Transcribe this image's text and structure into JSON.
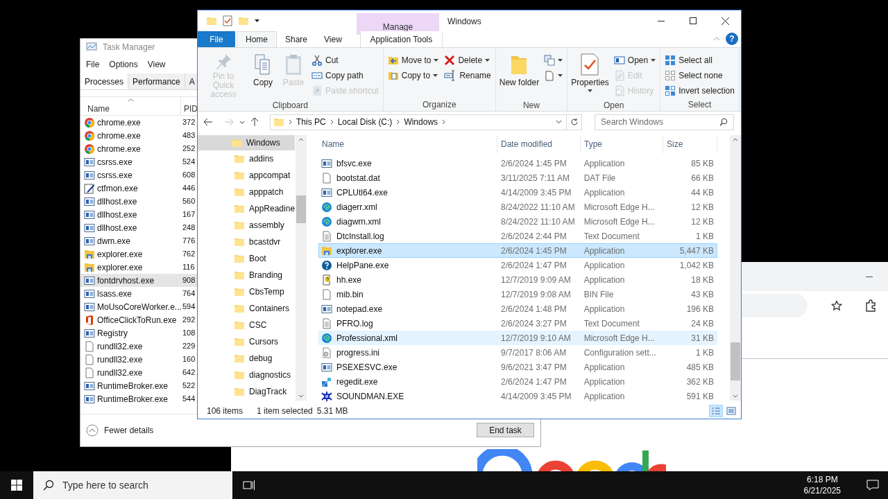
{
  "task_manager": {
    "title": "Task Manager",
    "menu": [
      "File",
      "Options",
      "View"
    ],
    "tabs": [
      {
        "label": "Processes",
        "selected": true
      },
      {
        "label": "Performance",
        "selected": false
      },
      {
        "label": "A",
        "selected": false
      }
    ],
    "columns": [
      "Name",
      "PID"
    ],
    "rows": [
      {
        "name": "chrome.exe",
        "pid": "372",
        "kind": "chrome",
        "selected": false
      },
      {
        "name": "chrome.exe",
        "pid": "483",
        "kind": "chrome",
        "selected": false
      },
      {
        "name": "chrome.exe",
        "pid": "252",
        "kind": "chrome",
        "selected": false
      },
      {
        "name": "csrss.exe",
        "pid": "524",
        "kind": "app",
        "selected": false
      },
      {
        "name": "csrss.exe",
        "pid": "608",
        "kind": "app",
        "selected": false
      },
      {
        "name": "ctfmon.exe",
        "pid": "446",
        "kind": "pen",
        "selected": false
      },
      {
        "name": "dllhost.exe",
        "pid": "560",
        "kind": "app",
        "selected": false
      },
      {
        "name": "dllhost.exe",
        "pid": "167",
        "kind": "app",
        "selected": false
      },
      {
        "name": "dllhost.exe",
        "pid": "248",
        "kind": "app",
        "selected": false
      },
      {
        "name": "dwm.exe",
        "pid": "776",
        "kind": "app",
        "selected": false
      },
      {
        "name": "explorer.exe",
        "pid": "762",
        "kind": "explorer",
        "selected": false
      },
      {
        "name": "explorer.exe",
        "pid": "116",
        "kind": "explorer",
        "selected": false
      },
      {
        "name": "fontdrvhost.exe",
        "pid": "908",
        "kind": "app",
        "selected": true
      },
      {
        "name": "lsass.exe",
        "pid": "764",
        "kind": "app",
        "selected": false
      },
      {
        "name": "MoUsoCoreWorker.e...",
        "pid": "594",
        "kind": "app",
        "selected": false
      },
      {
        "name": "OfficeClickToRun.exe",
        "pid": "292",
        "kind": "office",
        "selected": false
      },
      {
        "name": "Registry",
        "pid": "108",
        "kind": "app",
        "selected": false
      },
      {
        "name": "rundll32.exe",
        "pid": "229",
        "kind": "blank",
        "selected": false
      },
      {
        "name": "rundll32.exe",
        "pid": "160",
        "kind": "blank",
        "selected": false
      },
      {
        "name": "rundll32.exe",
        "pid": "642",
        "kind": "blank",
        "selected": false
      },
      {
        "name": "RuntimeBroker.exe",
        "pid": "522",
        "kind": "app",
        "selected": false
      },
      {
        "name": "RuntimeBroker.exe",
        "pid": "544",
        "kind": "app",
        "selected": false
      }
    ],
    "fewer_details": "Fewer details",
    "end_task": "End task"
  },
  "explorer": {
    "title": "Windows",
    "context_tab": "Manage",
    "tabs": [
      {
        "label": "File",
        "kind": "file",
        "selected": false
      },
      {
        "label": "Home",
        "kind": "tab",
        "selected": true
      },
      {
        "label": "Share",
        "kind": "tab",
        "selected": false
      },
      {
        "label": "View",
        "kind": "tab",
        "selected": false
      },
      {
        "label": "Application Tools",
        "kind": "context",
        "selected": false
      }
    ],
    "help": "?",
    "ribbon": [
      {
        "label": "Clipboard",
        "columns": [
          [
            {
              "kind": "big",
              "label": "Pin to Quick access",
              "disabled": true
            }
          ],
          [
            {
              "kind": "big",
              "label": "Copy",
              "disabled": false
            }
          ],
          [
            {
              "kind": "big",
              "label": "Paste",
              "disabled": true
            }
          ],
          [
            {
              "kind": "small",
              "label": "Cut",
              "disabled": false
            },
            {
              "kind": "small",
              "label": "Copy path",
              "disabled": false
            },
            {
              "kind": "small",
              "label": "Paste shortcut",
              "disabled": true
            }
          ]
        ]
      },
      {
        "label": "Organize",
        "columns": [
          [
            {
              "kind": "small",
              "label": "Move to",
              "disabled": false,
              "dropdown": true
            },
            {
              "kind": "small",
              "label": "Copy to",
              "disabled": false,
              "dropdown": true
            }
          ],
          [
            {
              "kind": "small",
              "label": "Delete",
              "disabled": false,
              "dropdown": true
            },
            {
              "kind": "small",
              "label": "Rename",
              "disabled": false
            }
          ]
        ]
      },
      {
        "label": "New",
        "columns": [
          [
            {
              "kind": "big",
              "label": "New folder",
              "disabled": false
            }
          ],
          [
            {
              "kind": "icon",
              "disabled": false,
              "dropdown": true
            },
            {
              "kind": "icon",
              "disabled": false,
              "dropdown": true
            }
          ]
        ]
      },
      {
        "label": "Open",
        "columns": [
          [
            {
              "kind": "big",
              "label": "Properties",
              "disabled": false,
              "dropdown": true
            }
          ],
          [
            {
              "kind": "small",
              "label": "Open",
              "disabled": false,
              "dropdown": true
            },
            {
              "kind": "small",
              "label": "Edit",
              "disabled": true
            },
            {
              "kind": "small",
              "label": "History",
              "disabled": true
            }
          ]
        ]
      },
      {
        "label": "Select",
        "columns": [
          [
            {
              "kind": "small",
              "label": "Select all",
              "disabled": false
            },
            {
              "kind": "small",
              "label": "Select none",
              "disabled": false
            },
            {
              "kind": "small",
              "label": "Invert selection",
              "disabled": false
            }
          ]
        ]
      }
    ],
    "breadcrumbs": [
      "This PC",
      "Local Disk (C:)",
      "Windows"
    ],
    "search": {
      "placeholder": "Search Windows"
    },
    "tree": [
      {
        "label": "Windows",
        "selected": true,
        "children": [
          {
            "label": "addins",
            "selected": false
          },
          {
            "label": "appcompat",
            "selected": false
          },
          {
            "label": "apppatch",
            "selected": false
          },
          {
            "label": "AppReadine",
            "selected": false
          },
          {
            "label": "assembly",
            "selected": false
          },
          {
            "label": "bcastdvr",
            "selected": false
          },
          {
            "label": "Boot",
            "selected": false
          },
          {
            "label": "Branding",
            "selected": false
          },
          {
            "label": "CbsTemp",
            "selected": false
          },
          {
            "label": "Containers",
            "selected": false
          },
          {
            "label": "CSC",
            "selected": false
          },
          {
            "label": "Cursors",
            "selected": false
          },
          {
            "label": "debug",
            "selected": false
          },
          {
            "label": "diagnostics",
            "selected": false
          },
          {
            "label": "DiagTrack",
            "selected": false
          }
        ]
      }
    ],
    "columns": [
      "Name",
      "Date modified",
      "Type",
      "Size"
    ],
    "files": [
      {
        "name": "bfsvc.exe",
        "date": "2/6/2024 1:45 PM",
        "type": "Application",
        "size": "85 KB",
        "kind": "app",
        "selected": false,
        "hot": false
      },
      {
        "name": "bootstat.dat",
        "date": "3/11/2025 7:11 AM",
        "type": "DAT File",
        "size": "66 KB",
        "kind": "blank",
        "selected": false,
        "hot": false
      },
      {
        "name": "CPLUtl64.exe",
        "date": "4/14/2009 3:45 PM",
        "type": "Application",
        "size": "44 KB",
        "kind": "app",
        "selected": false,
        "hot": false
      },
      {
        "name": "diagerr.xml",
        "date": "8/24/2022 11:10 AM",
        "type": "Microsoft Edge H...",
        "size": "12 KB",
        "kind": "edge",
        "selected": false,
        "hot": false
      },
      {
        "name": "diagwrn.xml",
        "date": "8/24/2022 11:10 AM",
        "type": "Microsoft Edge H...",
        "size": "12 KB",
        "kind": "edge",
        "selected": false,
        "hot": false
      },
      {
        "name": "DtcInstall.log",
        "date": "2/6/2024 2:44 PM",
        "type": "Text Document",
        "size": "1 KB",
        "kind": "text",
        "selected": false,
        "hot": false
      },
      {
        "name": "explorer.exe",
        "date": "2/6/2024 1:45 PM",
        "type": "Application",
        "size": "5,447 KB",
        "kind": "explorer",
        "selected": true,
        "hot": false
      },
      {
        "name": "HelpPane.exe",
        "date": "2/6/2024 1:47 PM",
        "type": "Application",
        "size": "1,042 KB",
        "kind": "help",
        "selected": false,
        "hot": false
      },
      {
        "name": "hh.exe",
        "date": "12/7/2019 9:09 AM",
        "type": "Application",
        "size": "18 KB",
        "kind": "hh",
        "selected": false,
        "hot": false
      },
      {
        "name": "mib.bin",
        "date": "12/7/2019 9:08 AM",
        "type": "BIN File",
        "size": "43 KB",
        "kind": "blank",
        "selected": false,
        "hot": false
      },
      {
        "name": "notepad.exe",
        "date": "2/6/2024 1:48 PM",
        "type": "Application",
        "size": "196 KB",
        "kind": "app",
        "selected": false,
        "hot": false
      },
      {
        "name": "PFRO.log",
        "date": "2/6/2024 3:27 PM",
        "type": "Text Document",
        "size": "24 KB",
        "kind": "text",
        "selected": false,
        "hot": false
      },
      {
        "name": "Professional.xml",
        "date": "12/7/2019 9:10 AM",
        "type": "Microsoft Edge H...",
        "size": "31 KB",
        "kind": "edge",
        "selected": false,
        "hot": true
      },
      {
        "name": "progress.ini",
        "date": "9/7/2017 8:06 AM",
        "type": "Configuration sett...",
        "size": "1 KB",
        "kind": "ini",
        "selected": false,
        "hot": false
      },
      {
        "name": "PSEXESVC.exe",
        "date": "9/6/2021 3:47 PM",
        "type": "Application",
        "size": "485 KB",
        "kind": "app",
        "selected": false,
        "hot": false
      },
      {
        "name": "regedit.exe",
        "date": "2/6/2024 1:47 PM",
        "type": "Application",
        "size": "362 KB",
        "kind": "regedit",
        "selected": false,
        "hot": false
      },
      {
        "name": "SOUNDMAN.EXE",
        "date": "4/14/2009 3:45 PM",
        "type": "Application",
        "size": "591 KB",
        "kind": "sound",
        "selected": false,
        "hot": false
      }
    ],
    "status": [
      "106 items",
      "1 item selected",
      "5.31 MB"
    ],
    "views": [
      {
        "kind": "details",
        "selected": true
      },
      {
        "kind": "large",
        "selected": false
      }
    ]
  },
  "taskbar": {
    "search_placeholder": "Type here to search",
    "time": "6:18 PM",
    "date": "6/21/2025"
  }
}
